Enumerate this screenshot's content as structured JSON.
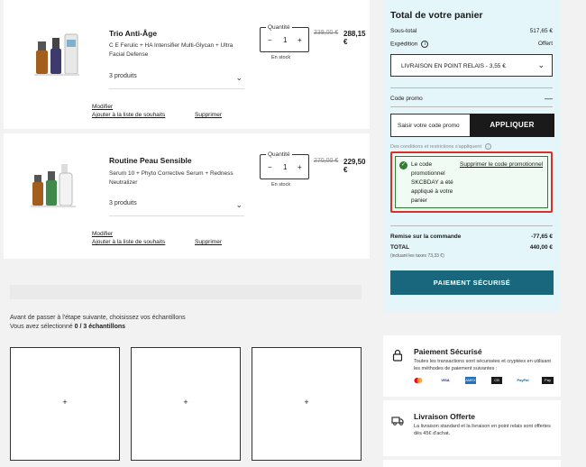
{
  "cart": {
    "products": [
      {
        "name": "Trio Anti-Âge",
        "description": "C E Ferulic + HA Intensifier Multi-Glycan + Ultra Facial Defense",
        "count": "3 produits",
        "qty_label": "Quantité",
        "qty": "1",
        "stock": "En stock",
        "old_price": "339,00 €",
        "new_price": "288,15 €",
        "modify": "Modifier",
        "wishlist": "Ajouter à la liste de souhaits",
        "delete": "Supprimer"
      },
      {
        "name": "Routine Peau Sensible",
        "description": "Serum 10 + Phyto Corrective Serum + Redness Neutralizer",
        "count": "3 produits",
        "qty_label": "Quantité",
        "qty": "1",
        "stock": "En stock",
        "old_price": "270,00 €",
        "new_price": "229,50 €",
        "modify": "Modifier",
        "wishlist": "Ajouter à la liste de souhaits",
        "delete": "Supprimer"
      }
    ],
    "qty_minus": "−",
    "qty_plus": "+"
  },
  "samples": {
    "prompt": "Avant de passer à l'étape suivante, choisissez vos échantillons",
    "selected_prefix": "Vous avez sélectionné",
    "selected_count": "0 / 3 échantillons",
    "add_symbol": "+"
  },
  "summary": {
    "title": "Total de votre panier",
    "subtotal_label": "Sous-total",
    "subtotal_value": "517,65 €",
    "shipping_label": "Expédition",
    "shipping_value": "Offert",
    "shipping_option": "LIVRAISON EN POINT RELAIS - 3,55 €",
    "promo_label": "Code promo",
    "promo_collapse": "—",
    "promo_placeholder": "Saisir votre code promo",
    "apply_label": "APPLIQUER",
    "conditions": "Des conditions et restrictions s'appliquent",
    "applied_message": "Le code promotionnel SKCBDAY a été appliqué à votre panier",
    "remove_promo": "Supprimer le code promotionnel",
    "discount_label": "Remise sur la commande",
    "discount_value": "-77,65 €",
    "total_label": "TOTAL",
    "total_value": "440,00 €",
    "tax_note": "(incluant les taxes 73,33 €)",
    "pay_button": "PAIEMENT SÉCURISÉ"
  },
  "info": {
    "payment_title": "Paiement Sécurisé",
    "payment_text": "Toutes les transactions sont sécurisées et cryptées en utilisant les méthodes de paiement suivantes :",
    "payment_methods": [
      "mastercard",
      "VISA",
      "AMEX",
      "CB",
      "PayPal",
      "Pay"
    ],
    "delivery_title": "Livraison Offerte",
    "delivery_text": "La livraison standard et la livraison en point relais sont offertes dès 45€ d'achat."
  },
  "colors": {
    "summary_bg": "#e5f6fa",
    "pay_button": "#18677d",
    "promo_highlight": "#d9302c",
    "success": "#2e7d32"
  }
}
